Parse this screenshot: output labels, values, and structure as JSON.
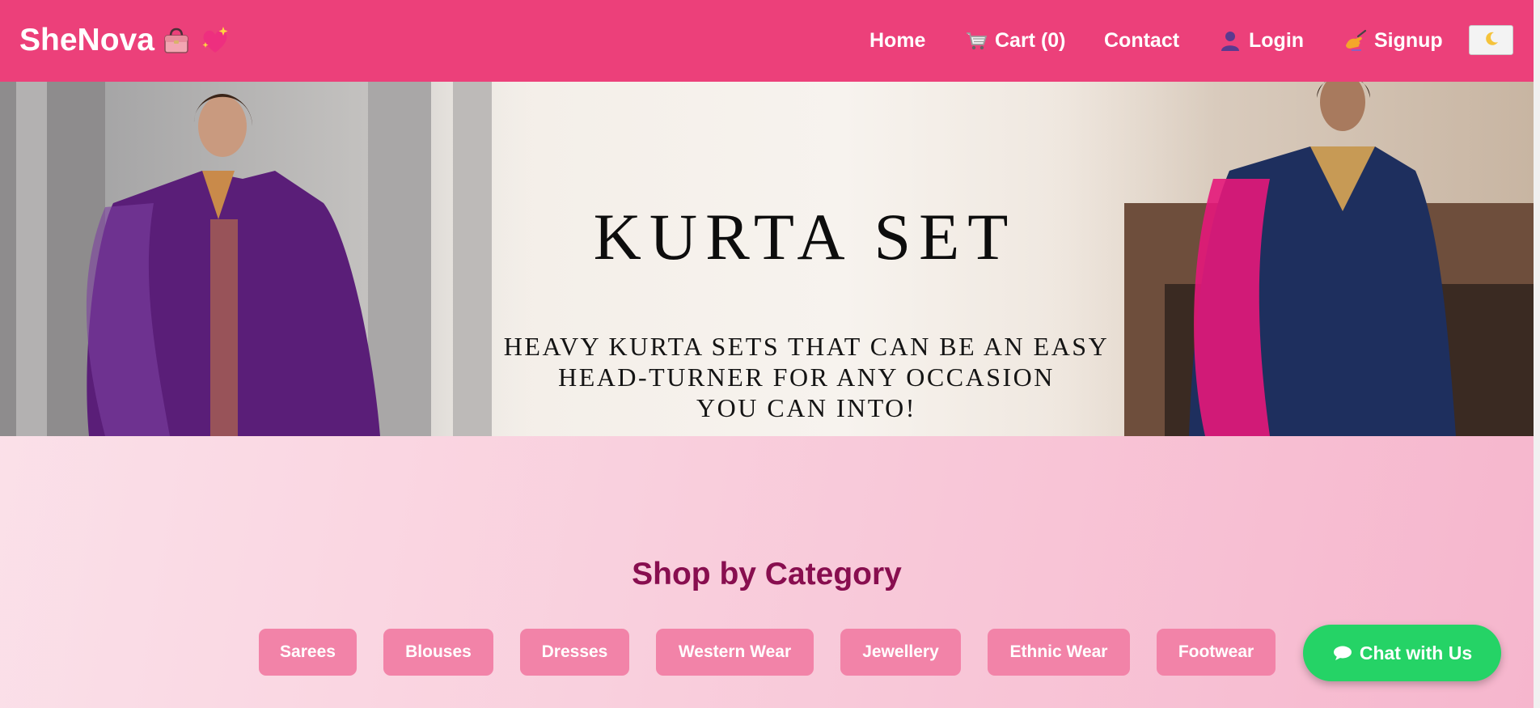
{
  "header": {
    "brand": "SheNova",
    "brand_icons": [
      "handbag-icon",
      "sparkling-heart-icon"
    ],
    "nav": {
      "home": "Home",
      "cart": "Cart (0)",
      "contact": "Contact",
      "login": "Login",
      "signup": "Signup"
    },
    "theme_toggle_icon": "crescent-moon-icon"
  },
  "hero": {
    "title": "KURTA SET",
    "subtitle_lines": [
      "HEAVY KURTA SETS THAT CAN BE AN EASY",
      "HEAD-TURNER FOR ANY OCCASION",
      "YOU CAN INTO!"
    ]
  },
  "categories": {
    "heading": "Shop by Category",
    "items": [
      "Sarees",
      "Blouses",
      "Dresses",
      "Western Wear",
      "Jewellery",
      "Ethnic Wear",
      "Footwear"
    ]
  },
  "chat": {
    "label": "Chat with Us",
    "icon": "speech-bubble-icon"
  },
  "colors": {
    "header_bg": "#ec407a",
    "category_bg": "#f283a8",
    "heading_color": "#880e4f",
    "chat_bg": "#25d366"
  }
}
